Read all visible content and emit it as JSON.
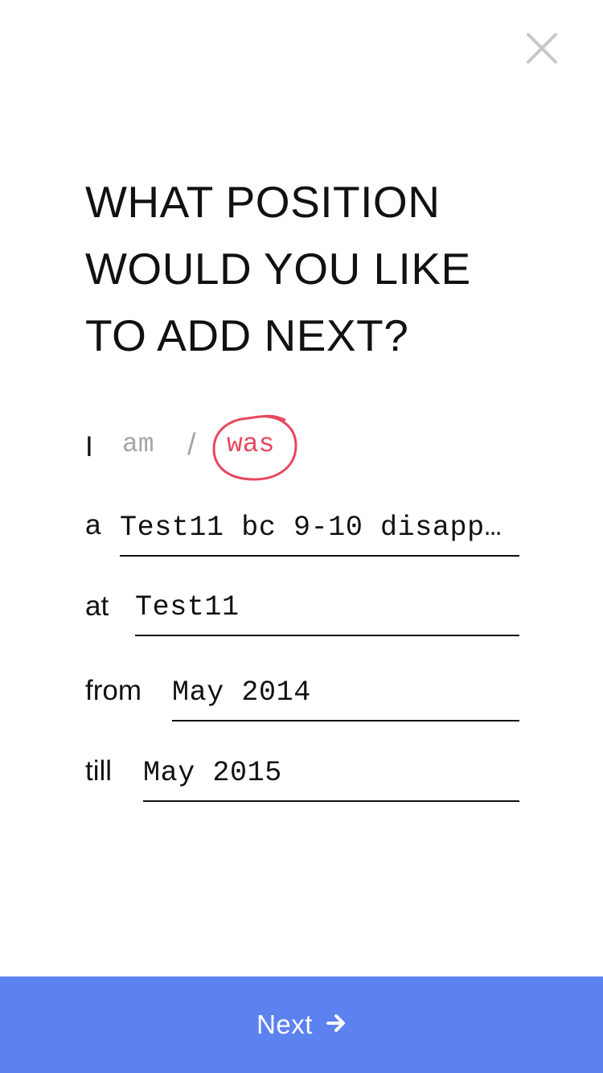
{
  "header": {
    "close_icon": "close-icon",
    "close_color": "#c8c8c8"
  },
  "title": {
    "lines": [
      "WHAT POSITION",
      "WOULD YOU LIKE",
      "TO ADD NEXT?"
    ]
  },
  "tense": {
    "prefix": "I",
    "option_present": "am",
    "separator": "/",
    "option_past": "was",
    "selected": "was",
    "selected_color": "#e8475f"
  },
  "form": {
    "position_prefix": "a",
    "position_value": "Test11 bc 9-10 disapp…",
    "company_prefix": "at",
    "company_value": "Test11",
    "from_prefix": "from",
    "from_value": "May 2014",
    "till_prefix": "till",
    "till_value": "May 2015"
  },
  "footer": {
    "next_label": "Next",
    "next_icon": "arrow-right-icon",
    "bar_color": "#5b82ee"
  }
}
